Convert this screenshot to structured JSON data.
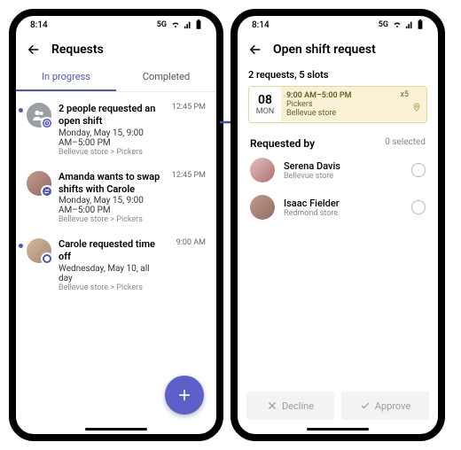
{
  "status": {
    "time": "8:14",
    "network": "5G"
  },
  "left": {
    "title": "Requests",
    "tabs": {
      "inprogress": "In progress",
      "completed": "Completed"
    },
    "items": [
      {
        "title": "2 people requested an open shift",
        "sub": "Monday, May 15, 9:00 AM–5:00 PM",
        "path": "Bellevue store > Pickers",
        "time": "12:45 PM"
      },
      {
        "title": "Amanda wants to swap shifts with Carole",
        "sub": "Monday, May 15, 9:00 AM–5:00 PM",
        "path": "Bellevue store > Pickers",
        "time": "12:45 PM"
      },
      {
        "title": "Carole requested time off",
        "sub": "Wednesday, May 10, all day",
        "path": "Bellevue store > Pickers",
        "time": "9:00 AM"
      }
    ]
  },
  "right": {
    "title": "Open shift request",
    "summary": "2 requests, 5 slots",
    "shift": {
      "day_num": "08",
      "day_name": "MON",
      "time": "9:00 AM–5:00 PM",
      "team": "Pickers",
      "store": "Bellevue store",
      "count": "x5"
    },
    "reqby": {
      "label": "Requested by",
      "selected": "0 selected"
    },
    "people": [
      {
        "name": "Serena Davis",
        "loc": "Bellevue store"
      },
      {
        "name": "Isaac Fielder",
        "loc": "Redmond store"
      }
    ],
    "actions": {
      "decline": "Decline",
      "approve": "Approve"
    }
  }
}
